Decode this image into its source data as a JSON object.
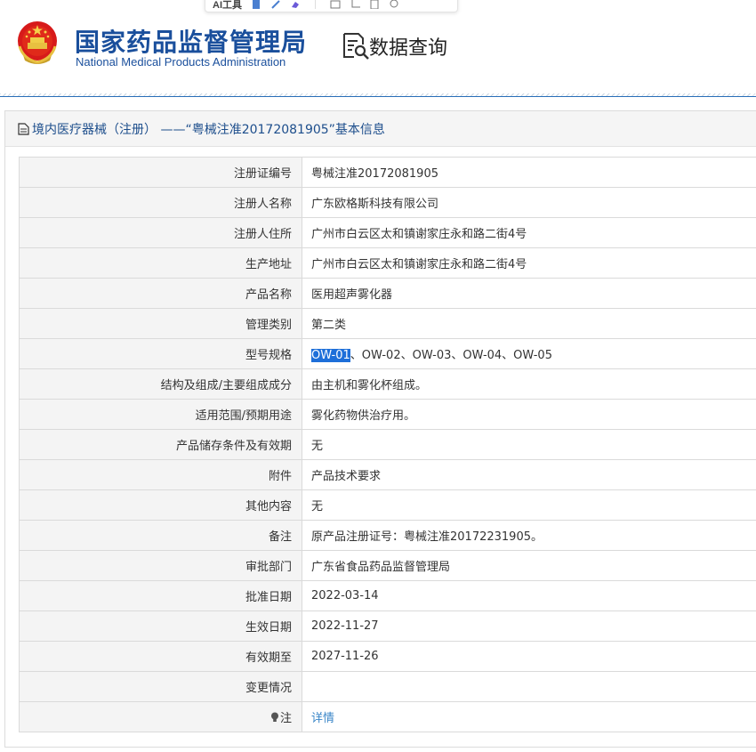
{
  "toolbar": {
    "ai_label": "AI工具"
  },
  "header": {
    "org_name_cn": "国家药品监督管理局",
    "org_name_en": "National Medical Products Administration",
    "section_title": "数据查询"
  },
  "panel": {
    "title": "境内医疗器械（注册） ——“粤械注准20172081905”基本信息"
  },
  "rows": [
    {
      "label": "注册证编号",
      "value": "粤械注准20172081905"
    },
    {
      "label": "注册人名称",
      "value": "广东欧格斯科技有限公司"
    },
    {
      "label": "注册人住所",
      "value": "广州市白云区太和镇谢家庄永和路二街4号"
    },
    {
      "label": "生产地址",
      "value": "广州市白云区太和镇谢家庄永和路二街4号"
    },
    {
      "label": "产品名称",
      "value": "医用超声雾化器"
    },
    {
      "label": "管理类别",
      "value": "第二类"
    },
    {
      "label": "型号规格",
      "value_selected": "OW-01",
      "value_rest": "、OW-02、OW-03、OW-04、OW-05"
    },
    {
      "label": "结构及组成/主要组成成分",
      "value": "由主机和雾化杯组成。"
    },
    {
      "label": "适用范围/预期用途",
      "value": "雾化药物供治疗用。"
    },
    {
      "label": "产品储存条件及有效期",
      "value": "无"
    },
    {
      "label": "附件",
      "value": "产品技术要求"
    },
    {
      "label": "其他内容",
      "value": "无"
    },
    {
      "label": "备注",
      "value": "原产品注册证号：粤械注准20172231905。"
    },
    {
      "label": "审批部门",
      "value": "广东省食品药品监督管理局"
    },
    {
      "label": "批准日期",
      "value": "2022-03-14"
    },
    {
      "label": "生效日期",
      "value": "2022-11-27"
    },
    {
      "label": "有效期至",
      "value": "2027-11-26"
    },
    {
      "label": "变更情况",
      "value": ""
    },
    {
      "label": "注",
      "value": "详情"
    }
  ],
  "colors": {
    "brand_blue": "#1a4f9c",
    "link_blue": "#3a86c8",
    "selection": "#1e6fd9"
  }
}
